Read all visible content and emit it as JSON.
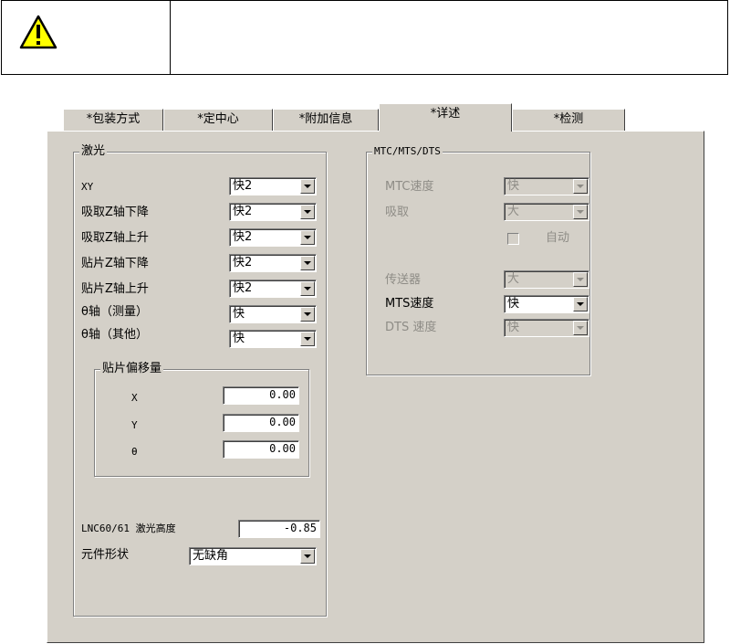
{
  "tabs": [
    {
      "label": "*包装方式",
      "active": false
    },
    {
      "label": "*定中心",
      "active": false
    },
    {
      "label": "*附加信息",
      "active": false
    },
    {
      "label": "*详述",
      "active": true
    },
    {
      "label": "*检测",
      "active": false
    }
  ],
  "laser": {
    "legend": "激光",
    "rows": [
      {
        "label": "XY",
        "value": "快2"
      },
      {
        "label": "吸取Z轴下降",
        "value": "快2"
      },
      {
        "label": "吸取Z轴上升",
        "value": "快2"
      },
      {
        "label": "贴片Z轴下降",
        "value": "快2"
      },
      {
        "label": "贴片Z轴上升",
        "value": "快2"
      },
      {
        "label": "θ轴（测量）",
        "value": "快"
      },
      {
        "label": "θ轴（其他）",
        "value": "快"
      }
    ],
    "offset": {
      "legend": "贴片偏移量",
      "rows": [
        {
          "label": "X",
          "value": "0.00"
        },
        {
          "label": "Y",
          "value": "0.00"
        },
        {
          "label": "θ",
          "value": "0.00"
        }
      ]
    },
    "lnc_label": "LNC60/61 激光高度",
    "lnc_value": "-0.85",
    "shape_label": "元件形状",
    "shape_value": "无缺角"
  },
  "mtc": {
    "legend": "MTC/MTS/DTS",
    "mtc_speed_label": "MTC速度",
    "mtc_speed_value": "快",
    "pickup_label": "吸取",
    "pickup_value": "大",
    "auto_label": "自动",
    "conveyor_label": "传送器",
    "conveyor_value": "大",
    "mts_speed_label": "MTS速度",
    "mts_speed_value": "快",
    "dts_speed_label": "DTS 速度",
    "dts_speed_value": "快"
  },
  "colors": {
    "dialog_bg": "#d4d0c8",
    "warning_yellow": "#ffff00",
    "disabled_text": "#8e8c86"
  }
}
